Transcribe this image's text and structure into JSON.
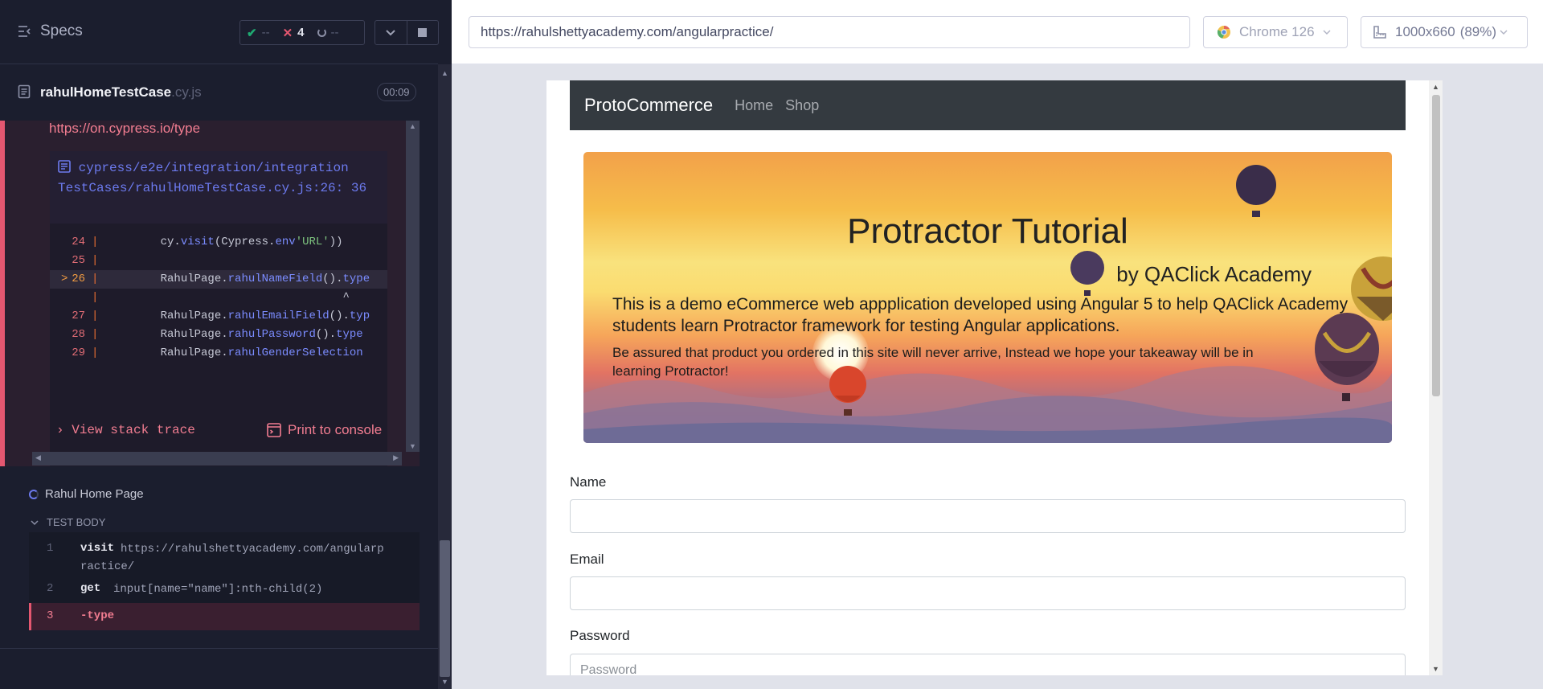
{
  "reporter": {
    "specs_label": "Specs",
    "stats": {
      "passed": "--",
      "failed": "4",
      "pending": "--"
    },
    "spec": {
      "name": "rahulHomeTestCase",
      "ext": ".cy.js",
      "duration": "00:09"
    },
    "error": {
      "docs_link": "https://on.cypress.io/type",
      "code_frame_path": "cypress/e2e/integration/integration TestCases/rahulHomeTestCase.cy.js:26: 36",
      "code_lines": [
        {
          "n": "24",
          "marker": "",
          "pre": "        cy.",
          "fn": "visit",
          "mid": "(Cypress.",
          "fn2": "env",
          "str": "'URL'",
          "post": "))"
        },
        {
          "n": "25",
          "marker": "",
          "pre": "",
          "fn": "",
          "mid": "",
          "fn2": "",
          "str": "",
          "post": ""
        },
        {
          "n": "26",
          "marker": ">",
          "pre": "        RahulPage.",
          "fn": "rahulNameField",
          "mid": "().",
          "fn2": "type",
          "str": "",
          "post": ""
        },
        {
          "n": "",
          "marker": "",
          "pre": "                                   ^",
          "fn": "",
          "mid": "",
          "fn2": "",
          "str": "",
          "post": ""
        },
        {
          "n": "27",
          "marker": "",
          "pre": "        RahulPage.",
          "fn": "rahulEmailField",
          "mid": "().",
          "fn2": "typ",
          "str": "",
          "post": ""
        },
        {
          "n": "28",
          "marker": "",
          "pre": "        RahulPage.",
          "fn": "rahulPassword",
          "mid": "().",
          "fn2": "type",
          "str": "",
          "post": ""
        },
        {
          "n": "29",
          "marker": "",
          "pre": "        RahulPage.",
          "fn": "rahulGenderSelection",
          "mid": "",
          "fn2": "",
          "str": "",
          "post": ""
        }
      ],
      "view_stack_trace": "View stack trace",
      "print_to_console": "Print to console"
    },
    "suite_title": "Rahul Home Page",
    "test_body_label": "TEST BODY",
    "commands": [
      {
        "n": "1",
        "name": "visit",
        "msg": "https://rahulshettyacademy.com/angularp ractice/"
      },
      {
        "n": "2",
        "name": "get",
        "msg": "input[name=\"name\"]:nth-child(2)"
      },
      {
        "n": "3",
        "name": "-type",
        "msg": ""
      }
    ]
  },
  "aut": {
    "url": "https://rahulshettyacademy.com/angularpractice/",
    "browser": "Chrome 126",
    "viewport": "1000x660",
    "zoom": "(89%)",
    "page": {
      "brand": "ProtoCommerce",
      "nav": [
        "Home",
        "Shop"
      ],
      "hero_title": "Protractor Tutorial",
      "hero_sub": "by QAClick Academy",
      "hero_lead": "This is a demo eCommerce web appplication developed using Angular 5 to help QAClick Academy students learn Protractor framework for testing Angular applications.",
      "hero_small": "Be assured that product you ordered in this site will never arrive, Instead we hope your takeaway will be in learning Protractor!",
      "form": {
        "name_label": "Name",
        "name_value": "",
        "email_label": "Email",
        "email_value": "",
        "password_label": "Password",
        "password_placeholder": "Password"
      }
    }
  },
  "colors": {
    "fail": "#e45770",
    "pass": "#1fa971",
    "accent": "#6c7aee"
  }
}
